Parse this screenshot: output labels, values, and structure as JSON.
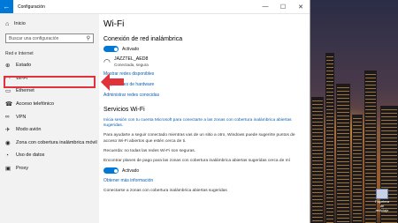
{
  "window": {
    "title": "Configuración",
    "controls": {
      "minimize": "—",
      "maximize": "☐",
      "close": "✕"
    }
  },
  "sidebar": {
    "home_label": "Inicio",
    "search_placeholder": "Buscar una configuración",
    "section_label": "Red e Internet",
    "items": [
      {
        "label": "Estado",
        "icon": "globe-icon",
        "glyph": "⊕"
      },
      {
        "label": "Wi-Fi",
        "icon": "wifi-icon",
        "glyph": "◠"
      },
      {
        "label": "Ethernet",
        "icon": "ethernet-icon",
        "glyph": "▭"
      },
      {
        "label": "Acceso telefónico",
        "icon": "dialup-icon",
        "glyph": "☎"
      },
      {
        "label": "VPN",
        "icon": "vpn-icon",
        "glyph": "∞"
      },
      {
        "label": "Modo avión",
        "icon": "airplane-icon",
        "glyph": "✈"
      },
      {
        "label": "Zona con cobertura inalámbrica móvil",
        "icon": "hotspot-icon",
        "glyph": "◉"
      },
      {
        "label": "Uso de datos",
        "icon": "data-usage-icon",
        "glyph": "◔"
      },
      {
        "label": "Proxy",
        "icon": "proxy-icon",
        "glyph": "▣"
      }
    ]
  },
  "content": {
    "title": "Wi-Fi",
    "wireless_heading": "Conexión de red inalámbrica",
    "toggle_label": "Activado",
    "network": {
      "name": "JAZZTEL_AED8",
      "status": "Conectada, segura"
    },
    "links": {
      "available": "Mostrar redes disponibles",
      "hardware": "Propiedades de hardware",
      "known": "Administrar redes conocidas"
    },
    "services_heading": "Servicios Wi-Fi",
    "signin_link": "Inicia sesión con tu cuenta Microsoft para conectarte a las zonas con cobertura inalámbrica abiertas sugeridas.",
    "help_text": "Para ayudarte a seguir conectado mientras vas de un sitio a otro, Windows puede sugerirte puntos de acceso Wi-Fi abiertos que estén cerca de ti.",
    "reminder_text": "Recuerda: no todas las redes Wi-Fi son seguras.",
    "paid_plans_text": "Encontrar planes de pago para las zonas con cobertura inalámbrica abiertas sugeridas cerca de mí",
    "toggle2_label": "Activado",
    "more_info_link": "Obtener más información",
    "connect_text": "Conectarse a zonas con cobertura inalámbrica abiertas sugeridas"
  },
  "desktop": {
    "icon_label": "Papelera de reciclaje"
  },
  "colors": {
    "accent": "#0078d7",
    "highlight": "#e0323b",
    "link": "#0a5fb4"
  }
}
